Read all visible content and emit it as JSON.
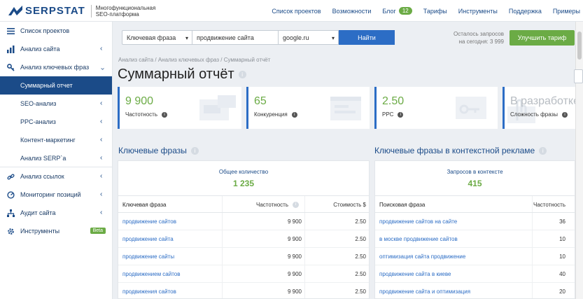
{
  "brand": {
    "name": "SERPSTAT",
    "tagline_1": "Многофункциональная",
    "tagline_2": "SEO-платформа"
  },
  "nav": {
    "projects": "Список проектов",
    "features": "Возможности",
    "blog": "Блог",
    "blog_count": "12",
    "pricing": "Тарифы",
    "tools": "Инструменты",
    "support": "Поддержка",
    "examples": "Примеры"
  },
  "sidebar": {
    "items": [
      {
        "label": "Список проектов",
        "icon": "menu-icon"
      },
      {
        "label": "Анализ сайта",
        "icon": "site-analysis-icon"
      },
      {
        "label": "Анализ ключевых фраз",
        "icon": "key-icon"
      },
      {
        "label": "Суммарный отчет",
        "icon": ""
      },
      {
        "label": "SEO-анализ",
        "icon": ""
      },
      {
        "label": "PPC-анализ",
        "icon": ""
      },
      {
        "label": "Контент-маркетинг",
        "icon": ""
      },
      {
        "label": "Анализ SERP`a",
        "icon": ""
      },
      {
        "label": "Анализ ссылок",
        "icon": "link-icon"
      },
      {
        "label": "Мониторинг позиций",
        "icon": "monitoring-icon"
      },
      {
        "label": "Аудит сайта",
        "icon": "audit-icon"
      },
      {
        "label": "Инструменты",
        "icon": "gear-icon"
      }
    ],
    "beta": "Beta"
  },
  "search": {
    "mode": "Ключевая фраза",
    "query": "продвижение сайта",
    "engine": "google.ru",
    "button": "Найти"
  },
  "quota": {
    "line1": "Осталось запросов",
    "line2": "на сегодня: 3 999"
  },
  "upgrade": "Улучшить тариф",
  "breadcrumb": "Анализ сайта / Анализ ключевых фраз / Суммарный отчёт",
  "title": "Суммарный отчёт",
  "kpis": [
    {
      "value": "9 900",
      "label": "Частотность"
    },
    {
      "value": "65",
      "label": "Конкуренция"
    },
    {
      "value": "2.50",
      "label": "PPC"
    },
    {
      "value": "В разработке",
      "label": "Сложность фразы"
    }
  ],
  "keywords": {
    "title": "Ключевые фразы",
    "total_label": "Общее количество",
    "total_value": "1 235",
    "columns": [
      "Ключевая фраза",
      "Частотность",
      "Стоимость $"
    ],
    "rows": [
      [
        "продвижение сайтов",
        "9 900",
        "2.50"
      ],
      [
        "продвижение сайта",
        "9 900",
        "2.50"
      ],
      [
        "продвижение сайты",
        "9 900",
        "2.50"
      ],
      [
        "продвижением сайтов",
        "9 900",
        "2.50"
      ],
      [
        "продвижения сайтов",
        "9 900",
        "2.50"
      ]
    ]
  },
  "ads": {
    "title": "Ключевые фразы в контекстной рекламе",
    "total_label": "Запросов в контексте",
    "total_value": "415",
    "columns": [
      "Поисковая фраза",
      "Частотность"
    ],
    "rows": [
      [
        "продвижение сайтов на сайте",
        "36"
      ],
      [
        "в москве продвижение сайтов",
        "10"
      ],
      [
        "оптимизация сайта продвижение",
        "10"
      ],
      [
        "продвижение сайта в киеве",
        "40"
      ],
      [
        "продвижение сайта и оптимизация",
        "20"
      ]
    ]
  },
  "colors": {
    "brand": "#1b4b88",
    "accent_green": "#6bab45",
    "button_blue": "#2c6dc5"
  }
}
